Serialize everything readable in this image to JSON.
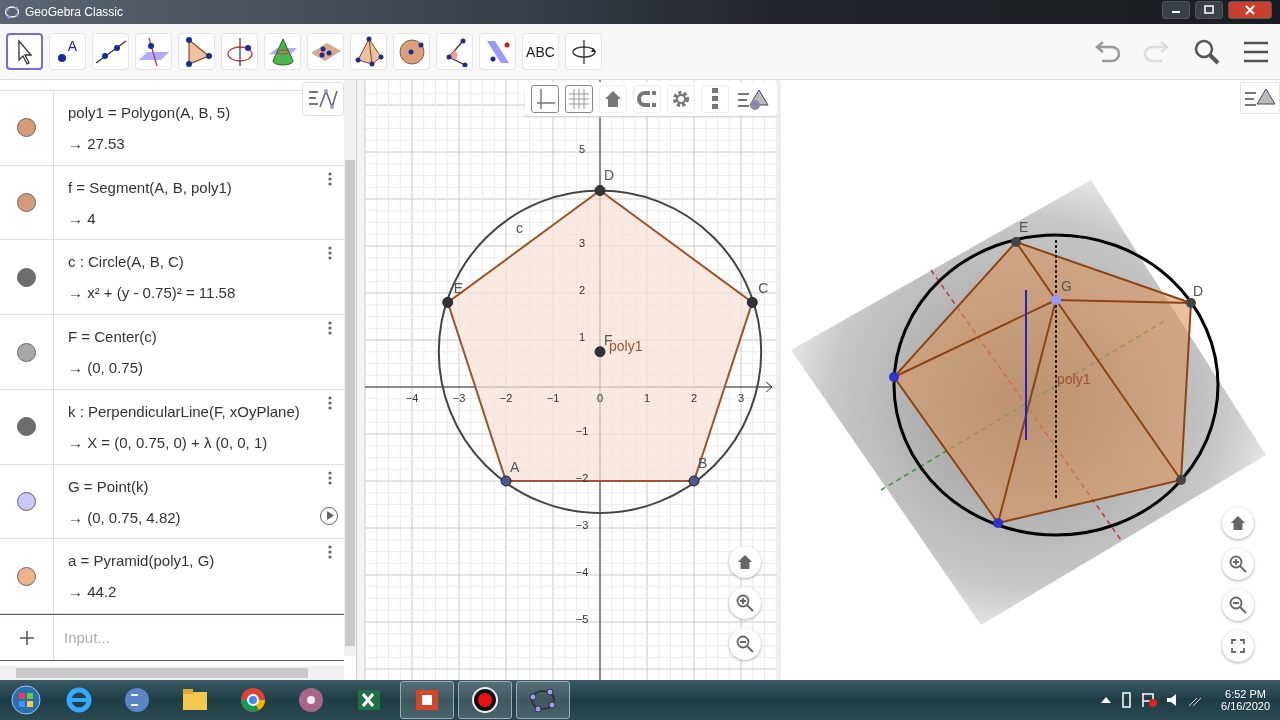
{
  "window": {
    "title": "GeoGebra Classic"
  },
  "toolbar": {
    "tools": [
      {
        "kind": "move",
        "selected": true
      },
      {
        "kind": "point",
        "label": "A",
        "selected": false
      },
      {
        "kind": "line",
        "selected": false
      },
      {
        "kind": "perpendicular",
        "selected": false
      },
      {
        "kind": "polygon",
        "selected": false
      },
      {
        "kind": "rotate-axis",
        "selected": false
      },
      {
        "kind": "cone",
        "selected": false
      },
      {
        "kind": "plane",
        "selected": false
      },
      {
        "kind": "pyramid",
        "selected": false
      },
      {
        "kind": "sphere",
        "selected": false
      },
      {
        "kind": "angle",
        "selected": false
      },
      {
        "kind": "reflect",
        "selected": false
      },
      {
        "kind": "text",
        "label": "ABC",
        "selected": false
      },
      {
        "kind": "rotate-view",
        "selected": false
      }
    ],
    "history": [
      {
        "kind": "undo",
        "disabled": false
      },
      {
        "kind": "redo",
        "disabled": true
      }
    ]
  },
  "algebra": {
    "items": [
      {
        "color": "#d49a7a",
        "definition": "poly1 = Polygon(A, B, 5)",
        "value": "→ 27.53",
        "animate": false
      },
      {
        "color": "#d49a7a",
        "definition": "f = Segment(A, B, poly1)",
        "value": "→ 4",
        "menu": true,
        "animate": false
      },
      {
        "color": "#6e6e6e",
        "definition": "c : Circle(A, B, C)",
        "value": "→ x² + (y - 0.75)² = 11.58",
        "menu": true,
        "animate": false
      },
      {
        "color": "#a8a8a8",
        "definition": "F = Center(c)",
        "value": "→ (0, 0.75)",
        "menu": true,
        "animate": false
      },
      {
        "color": "#6e6e6e",
        "definition": "k : PerpendicularLine(F, xOyPlane)",
        "value": "→ X = (0, 0.75, 0) + λ (0, 0, 1)",
        "menu": true,
        "animate": false
      },
      {
        "color": "#c8c8f8",
        "definition": "G = Point(k)",
        "value": "→ (0, 0.75, 4.82)",
        "menu": true,
        "animate": true
      },
      {
        "color": "#f2b38c",
        "definition": "a = Pyramid(poly1, G)",
        "value": "→ 44.2",
        "menu": true,
        "animate": false
      }
    ],
    "input": {
      "placeholder": "Input..."
    }
  },
  "graphics2d": {
    "style_bar": [
      {
        "kind": "axes",
        "selected": true
      },
      {
        "kind": "grid",
        "selected": true
      },
      {
        "kind": "home",
        "selected": false
      },
      {
        "kind": "snap",
        "selected": false
      },
      {
        "kind": "settings",
        "selected": false
      },
      {
        "kind": "more",
        "selected": false
      }
    ],
    "x_ticks": [
      "−4",
      "−3",
      "−2",
      "−1",
      "0",
      "1",
      "2",
      "3"
    ],
    "y_ticks": [
      "5",
      "3",
      "2",
      "1",
      "−1",
      "−2",
      "−3",
      "−4",
      "−5"
    ],
    "points": [
      {
        "label": "A",
        "kind": "free"
      },
      {
        "label": "B",
        "kind": "free"
      },
      {
        "label": "C",
        "kind": "dependent"
      },
      {
        "label": "D",
        "kind": "dependent"
      },
      {
        "label": "E",
        "kind": "dependent"
      },
      {
        "label": "F",
        "kind": "dependent"
      }
    ],
    "circle_label": "c",
    "polygon_label": "poly1"
  },
  "graphics3d": {
    "point_labels": [
      "E",
      "G",
      "D"
    ],
    "polygon_label": "poly1"
  },
  "taskbar": {
    "apps": [
      {
        "kind": "ie",
        "running": false
      },
      {
        "kind": "calculator",
        "running": false
      },
      {
        "kind": "explorer",
        "running": false
      },
      {
        "kind": "chrome",
        "running": false
      },
      {
        "kind": "media",
        "running": false
      },
      {
        "kind": "excel",
        "running": false
      },
      {
        "kind": "powerpoint",
        "running": true
      },
      {
        "kind": "recorder",
        "running": true
      },
      {
        "kind": "geogebra",
        "running": true
      }
    ],
    "time": "6:52 PM",
    "date": "6/16/2020"
  }
}
